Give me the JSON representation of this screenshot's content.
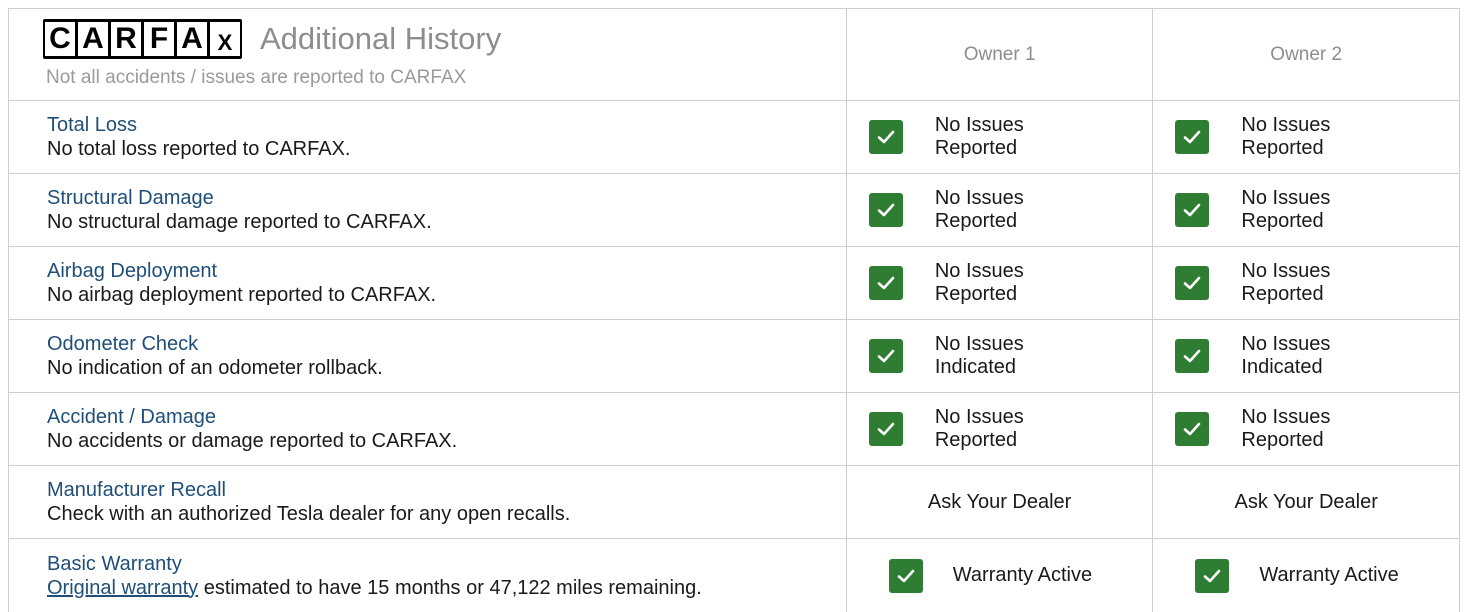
{
  "header": {
    "logo_letters": [
      "C",
      "A",
      "R",
      "F",
      "A",
      "X"
    ],
    "title": "Additional History",
    "subtitle": "Not all accidents / issues are reported to CARFAX",
    "owners": [
      "Owner 1",
      "Owner 2"
    ]
  },
  "colors": {
    "check_green": "#2e7d32",
    "title_blue": "#1f4e79",
    "muted_gray": "#8d8d8d"
  },
  "rows": [
    {
      "title": "Total Loss",
      "desc": "No total loss reported to CARFAX.",
      "status_line1": "No Issues",
      "status_line2": "Reported",
      "icon": "check-icon"
    },
    {
      "title": "Structural Damage",
      "desc": "No structural damage reported to CARFAX.",
      "status_line1": "No Issues",
      "status_line2": "Reported",
      "icon": "check-icon"
    },
    {
      "title": "Airbag Deployment",
      "desc": "No airbag deployment reported to CARFAX.",
      "status_line1": "No Issues",
      "status_line2": "Reported",
      "icon": "check-icon"
    },
    {
      "title": "Odometer Check",
      "desc": "No indication of an odometer rollback.",
      "status_line1": "No Issues",
      "status_line2": "Indicated",
      "icon": "check-icon"
    },
    {
      "title": "Accident / Damage",
      "desc": "No accidents or damage reported to CARFAX.",
      "status_line1": "No Issues",
      "status_line2": "Reported",
      "icon": "check-icon"
    }
  ],
  "recall": {
    "title": "Manufacturer Recall",
    "desc": "Check with an authorized Tesla dealer for any open recalls.",
    "status": "Ask Your Dealer"
  },
  "warranty": {
    "title": "Basic Warranty",
    "link_text": "Original warranty",
    "desc_rest": " estimated to have 15 months or 47,122 miles remaining.",
    "status": "Warranty Active",
    "icon": "check-icon"
  }
}
